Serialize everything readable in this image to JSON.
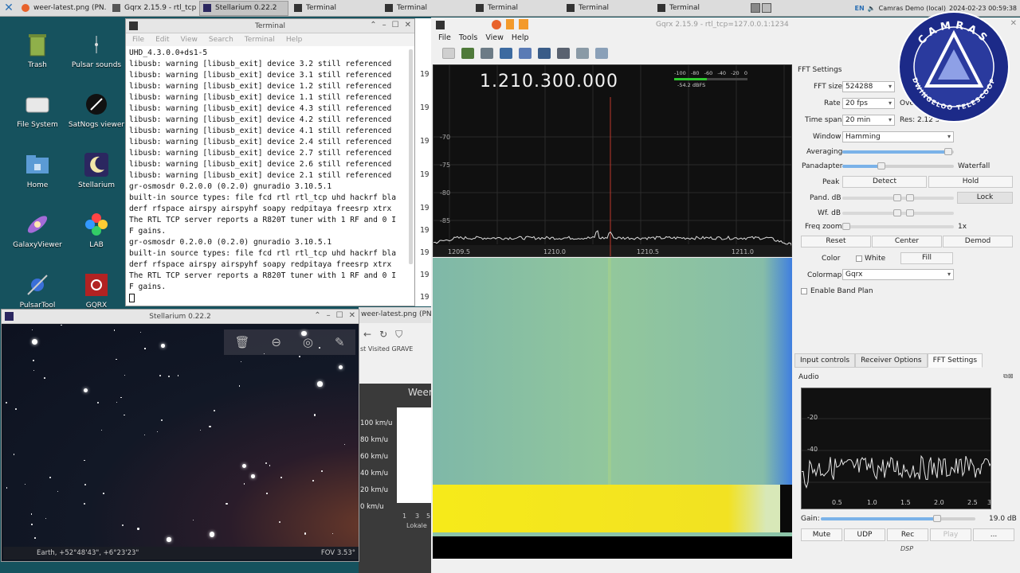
{
  "taskbar": {
    "tasks": [
      {
        "label": "weer-latest.png (PN...",
        "active": false
      },
      {
        "label": "Gqrx 2.15.9 - rtl_tcp...",
        "active": false
      },
      {
        "label": "Stellarium 0.22.2",
        "active": true
      },
      {
        "label": "Terminal",
        "active": false
      },
      {
        "label": "Terminal",
        "active": false
      },
      {
        "label": "Terminal",
        "active": false
      },
      {
        "label": "Terminal",
        "active": false
      },
      {
        "label": "Terminal",
        "active": false
      }
    ],
    "lang": "EN",
    "user": "Camras Demo (local)",
    "datetime": "2024-02-23 00:59:38"
  },
  "desktop": {
    "icons": [
      {
        "label": "Trash",
        "icon": "trash-icon"
      },
      {
        "label": "Pulsar sounds",
        "icon": "pulsar-sounds-icon"
      },
      {
        "label": "File System",
        "icon": "drive-icon"
      },
      {
        "label": "SatNogs viewer",
        "icon": "satnogs-icon"
      },
      {
        "label": "Home",
        "icon": "home-folder-icon"
      },
      {
        "label": "Stellarium",
        "icon": "stellarium-icon"
      },
      {
        "label": "GalaxyViewer",
        "icon": "galaxy-icon"
      },
      {
        "label": "LAB",
        "icon": "lab-icon"
      },
      {
        "label": "PulsarTool",
        "icon": "pulsartool-icon"
      },
      {
        "label": "GQRX",
        "icon": "gqrx-icon"
      }
    ]
  },
  "terminal": {
    "title": "Terminal",
    "menu": [
      "File",
      "Edit",
      "View",
      "Search",
      "Terminal",
      "Help"
    ],
    "lines": [
      "UHD_4.3.0.0+ds1-5",
      "libusb: warning [libusb_exit] device 3.2 still referenced",
      "libusb: warning [libusb_exit] device 3.1 still referenced",
      "libusb: warning [libusb_exit] device 1.2 still referenced",
      "libusb: warning [libusb_exit] device 1.1 still referenced",
      "libusb: warning [libusb_exit] device 4.3 still referenced",
      "libusb: warning [libusb_exit] device 4.2 still referenced",
      "libusb: warning [libusb_exit] device 4.1 still referenced",
      "libusb: warning [libusb_exit] device 2.4 still referenced",
      "libusb: warning [libusb_exit] device 2.7 still referenced",
      "libusb: warning [libusb_exit] device 2.6 still referenced",
      "libusb: warning [libusb_exit] device 2.1 still referenced",
      "gr-osmosdr 0.2.0.0 (0.2.0) gnuradio 3.10.5.1",
      "built-in source types: file fcd rtl rtl_tcp uhd hackrf bla",
      "derf rfspace airspy airspyhf soapy redpitaya freesrp xtrx",
      "The RTL TCP server reports a R820T tuner with 1 RF and 0 I",
      "F gains.",
      "gr-osmosdr 0.2.0.0 (0.2.0) gnuradio 3.10.5.1",
      "built-in source types: file fcd rtl rtl_tcp uhd hackrf bla",
      "derf rfspace airspy airspyhf soapy redpitaya freesrp xtrx",
      "The RTL TCP server reports a R820T tuner with 1 RF and 0 I",
      "F gains."
    ],
    "strip": [
      "19",
      "19",
      "19",
      "19",
      "19",
      "19",
      "19",
      "19",
      "19"
    ]
  },
  "browser": {
    "tab": "weer-latest.png (PNG",
    "bookmarks": "st Visited  GRAVE",
    "chart_title": "Weer",
    "yticks": [
      "100 km/u",
      "80 km/u",
      "60 km/u",
      "40 km/u",
      "20 km/u",
      "0 km/u"
    ],
    "xticks": [
      "1",
      "3",
      "5"
    ],
    "xlabel": "Lokale"
  },
  "stellarium": {
    "title": "Stellarium 0.22.2",
    "location": "Earth, +52°48'43\", +6°23'23\"",
    "fov": "FOV 3.53°"
  },
  "gqrx": {
    "title": "Gqrx 2.15.9 - rtl_tcp=127.0.0.1:1234",
    "menu": [
      "File",
      "Tools",
      "View",
      "Help"
    ],
    "frequency": "1.210.300.000",
    "meter_scale": [
      "-100",
      "-80",
      "-60",
      "-40",
      "-20",
      "0"
    ],
    "meter_level": 0.45,
    "meter_dbfs": "-54.2 dBFS",
    "fft_yticks": [
      "-70",
      "-75",
      "-80",
      "-85"
    ],
    "fft_xticks": [
      "1209.5",
      "1210.0",
      "1210.5",
      "1211.0"
    ],
    "fft_panel": {
      "heading": "FFT Settings",
      "fft_size_label": "FFT size",
      "fft_size": "524288",
      "rate_label": "Rate",
      "rate": "20 fps",
      "overlap_label": "Ove",
      "timespan_label": "Time span",
      "timespan": "20 min",
      "res": "Res: 2.12 s",
      "window_label": "Window",
      "window": "Hamming",
      "averaging_label": "Averaging",
      "averaging_level": 0.95,
      "panadapter_label": "Panadapter",
      "waterfall_label": "Waterfall",
      "pw_level": 0.35,
      "peak_label": "Peak",
      "detect": "Detect",
      "hold": "Hold",
      "pand_db_label": "Pand. dB",
      "wf_db_label": "Wf. dB",
      "lock": "Lock",
      "freq_zoom_label": "Freq zoom",
      "freq_zoom": "1x",
      "reset": "Reset",
      "center": "Center",
      "demod": "Demod",
      "color_label": "Color",
      "white": "White",
      "fill": "Fill",
      "colormap_label": "Colormap",
      "colormap": "Gqrx",
      "band_plan": "Enable Band Plan"
    },
    "tabs": [
      "Input controls",
      "Receiver Options",
      "FFT Settings"
    ],
    "audio": {
      "heading": "Audio",
      "yticks": [
        "-20",
        "-40"
      ],
      "xticks": [
        "0.5",
        "1.0",
        "1.5",
        "2.0",
        "2.5",
        "3"
      ],
      "gain_label": "Gain:",
      "gain": "19.0 dB",
      "gain_level": 0.75,
      "mute": "Mute",
      "udp": "UDP",
      "rec": "Rec",
      "play": "Play",
      "more": "...",
      "dsp": "DSP"
    }
  },
  "logo": {
    "top": "CAMRAS",
    "bottom": "DWINGELOO TELESCOOP"
  }
}
